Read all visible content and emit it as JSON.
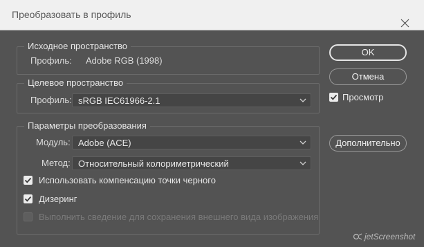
{
  "window": {
    "title": "Преобразовать в профиль"
  },
  "source": {
    "legend": "Исходное пространство",
    "profile_label": "Профиль:",
    "profile_value": "Adobe RGB (1998)"
  },
  "destination": {
    "legend": "Целевое пространство",
    "profile_label": "Профиль:",
    "profile_selected": "sRGB IEC61966-2.1"
  },
  "conversion": {
    "legend": "Параметры преобразования",
    "engine_label": "Модуль:",
    "engine_selected": "Adobe (ACE)",
    "intent_label": "Метод:",
    "intent_selected": "Относительный колориметрический",
    "black_point": {
      "label": "Использовать компенсацию точки черного",
      "checked": true
    },
    "dither": {
      "label": "Дизеринг",
      "checked": true
    },
    "flatten": {
      "label": "Выполнить сведение для сохранения внешнего вида изображения",
      "checked": false,
      "enabled": false
    }
  },
  "buttons": {
    "ok": "OK",
    "cancel": "Отмена",
    "advanced": "Дополнительно"
  },
  "preview": {
    "label": "Просмотр",
    "checked": true
  },
  "watermark": {
    "text": "jetScreenshot"
  },
  "icons": {
    "close": "close-icon",
    "chevron": "chevron-down-icon",
    "check": "checkmark-icon"
  },
  "colors": {
    "dialog_bg": "#535353",
    "titlebar_bg": "#f0f0f0",
    "field_bg": "#454545",
    "checkbox_bg": "#ececec"
  }
}
